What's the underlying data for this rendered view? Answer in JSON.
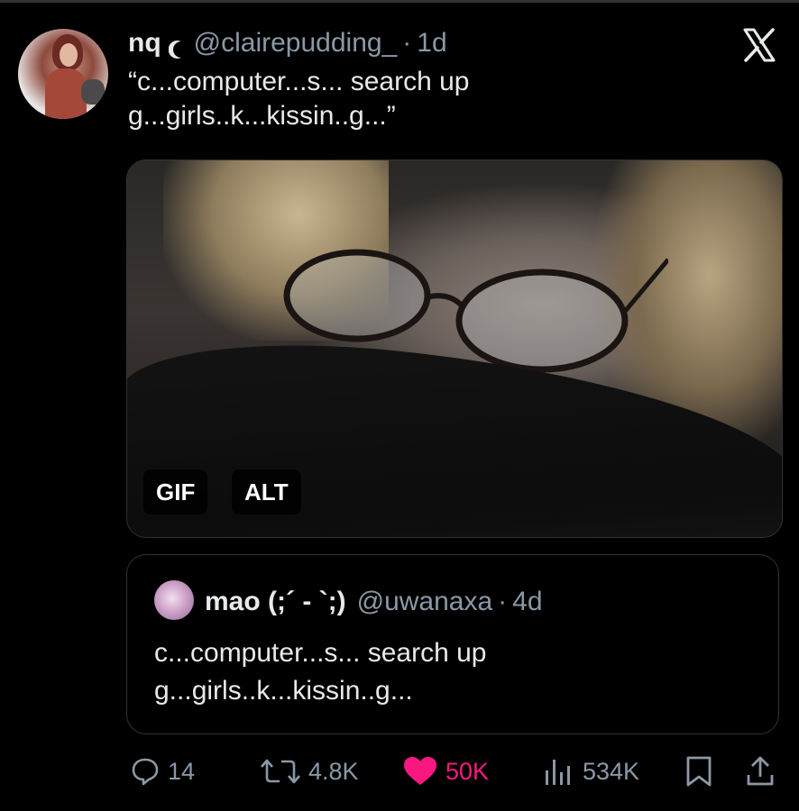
{
  "post": {
    "author_name": "nq",
    "author_handle": "@clairepudding_",
    "separator": "·",
    "timestamp": "1d",
    "text": "“c...computer...s... search up\ng...girls..k...kissin..g...”",
    "media": {
      "gif_label": "GIF",
      "alt_label": "ALT"
    }
  },
  "quoted_post": {
    "author_name": "mao (;´ - `;)",
    "author_handle": "@uwanaxa",
    "separator": "·",
    "timestamp": "4d",
    "text": "c...computer...s... search up\ng...girls..k...kissin..g..."
  },
  "actions": {
    "replies": "14",
    "reposts": "4.8K",
    "likes": "50K",
    "views": "534K"
  },
  "icons": {
    "brand": "x-logo",
    "badge": "crescent-moon-icon",
    "reply": "reply-icon",
    "repost": "repost-icon",
    "like": "heart-icon",
    "views": "views-icon",
    "bookmark": "bookmark-icon",
    "share": "share-icon"
  },
  "colors": {
    "background": "#000000",
    "text_primary": "#e7e9ea",
    "text_secondary": "#8b98a5",
    "like_active": "#f91880",
    "border": "#2f3336"
  }
}
